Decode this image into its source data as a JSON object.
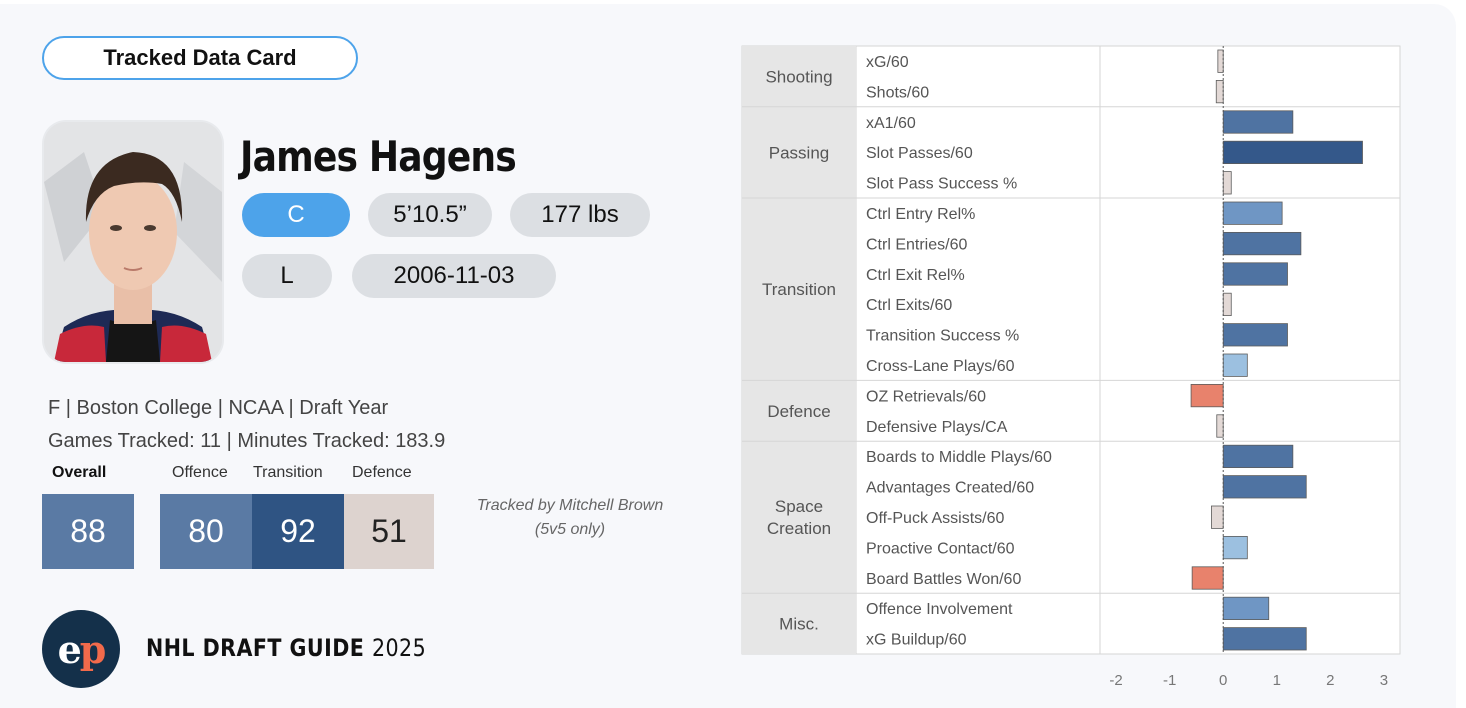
{
  "card_tag": "Tracked Data Card",
  "player": {
    "name": "James Hagens",
    "position": "C",
    "height": "5’10.5”",
    "weight": "177 lbs",
    "shoots": "L",
    "dob": "2006-11-03"
  },
  "meta_line1": "F | Boston College | NCAA | Draft Year",
  "meta_line2": "Games Tracked: 11 | Minutes Tracked: 183.9",
  "scores": {
    "overall_label": "Overall",
    "overall": "88",
    "offence_label": "Offence",
    "offence": "80",
    "transition_label": "Transition",
    "transition": "92",
    "defence_label": "Defence",
    "defence": "51"
  },
  "tracked_by": "Tracked by Mitchell Brown",
  "tracked_note": "(5v5 only)",
  "brand": {
    "logo_text_e": "e",
    "logo_text_p": "p",
    "guide_title": "NHL DRAFT GUIDE",
    "guide_year": "2025"
  },
  "colors": {
    "accent": "#4da3ea",
    "overall_box": "#5a7aa4",
    "offence_box": "#5a7aa4",
    "transition_box": "#2f5483",
    "defence_box": "#ddd3cf",
    "negative_bar": "#e8826c",
    "neutral_bar": "#e3d9d6"
  },
  "chart_data": {
    "type": "bar",
    "orientation": "horizontal",
    "xlim": [
      -2.3,
      3.3
    ],
    "xticks": [
      "-2",
      "-1",
      "0",
      "1",
      "2",
      "3"
    ],
    "categories": [
      {
        "name": "Shooting",
        "metrics": [
          {
            "label": "xG/60",
            "value": -0.1
          },
          {
            "label": "Shots/60",
            "value": -0.13
          }
        ]
      },
      {
        "name": "Passing",
        "metrics": [
          {
            "label": "xA1/60",
            "value": 1.3
          },
          {
            "label": "Slot Passes/60",
            "value": 2.6
          },
          {
            "label": "Slot Pass Success %",
            "value": 0.15
          }
        ]
      },
      {
        "name": "Transition",
        "metrics": [
          {
            "label": "Ctrl Entry Rel%",
            "value": 1.1
          },
          {
            "label": "Ctrl Entries/60",
            "value": 1.45
          },
          {
            "label": "Ctrl Exit Rel%",
            "value": 1.2
          },
          {
            "label": "Ctrl Exits/60",
            "value": 0.15
          },
          {
            "label": "Transition Success %",
            "value": 1.2
          },
          {
            "label": "Cross-Lane Plays/60",
            "value": 0.45
          }
        ]
      },
      {
        "name": "Defence",
        "metrics": [
          {
            "label": "OZ Retrievals/60",
            "value": -0.6
          },
          {
            "label": "Defensive Plays/CA",
            "value": -0.12
          }
        ]
      },
      {
        "name": "Space Creation",
        "metrics": [
          {
            "label": "Boards to Middle Plays/60",
            "value": 1.3
          },
          {
            "label": "Advantages Created/60",
            "value": 1.55
          },
          {
            "label": "Off-Puck Assists/60",
            "value": -0.22
          },
          {
            "label": "Proactive Contact/60",
            "value": 0.45
          },
          {
            "label": "Board Battles Won/60",
            "value": -0.58
          }
        ]
      },
      {
        "name": "Misc.",
        "metrics": [
          {
            "label": "Offence Involvement",
            "value": 0.85
          },
          {
            "label": "xG Buildup/60",
            "value": 1.55
          }
        ]
      }
    ]
  }
}
